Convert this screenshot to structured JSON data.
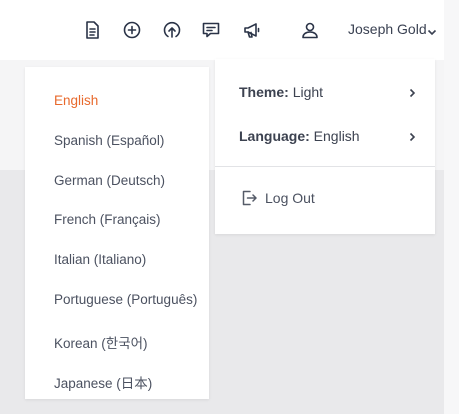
{
  "header": {
    "icons": [
      {
        "name": "document-icon"
      },
      {
        "name": "add-circle-icon"
      },
      {
        "name": "upload-icon"
      },
      {
        "name": "chat-icon"
      },
      {
        "name": "megaphone-icon"
      },
      {
        "name": "user-icon"
      }
    ],
    "user_name": "Joseph Gold"
  },
  "language_menu": {
    "items": [
      {
        "label": "English"
      },
      {
        "label": "Spanish (Español)"
      },
      {
        "label": "German (Deutsch)"
      },
      {
        "label": "French (Français)"
      },
      {
        "label": "Italian (Italiano)"
      },
      {
        "label": "Portuguese (Português)"
      },
      {
        "label": "Korean (한국어)"
      },
      {
        "label": "Japanese (日本)"
      }
    ],
    "selected": "English",
    "selected_color": "#e8692c"
  },
  "account_menu": {
    "theme_label": "Theme:",
    "theme_value": "Light",
    "language_label": "Language:",
    "language_value": "English",
    "logout_label": "Log Out"
  }
}
